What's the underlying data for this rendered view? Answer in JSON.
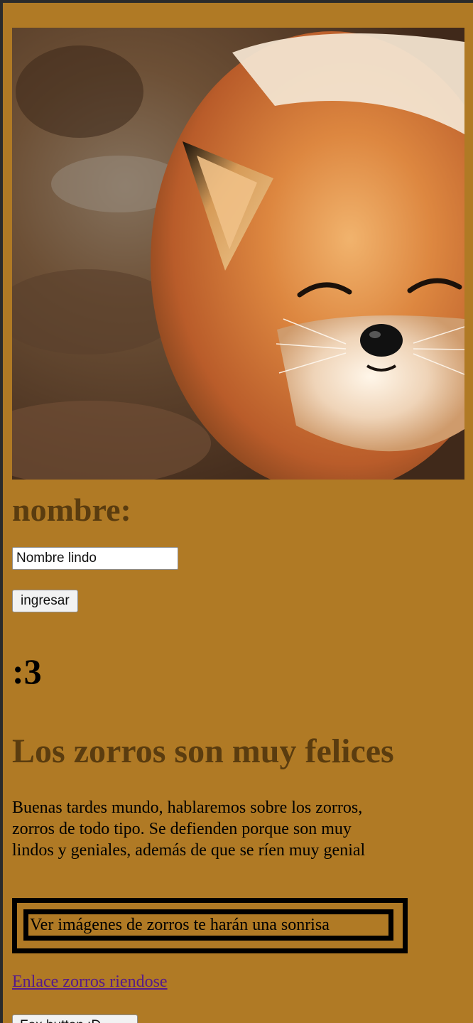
{
  "hero_image": {
    "alt": "",
    "subject": "smiling-red-fox-photo"
  },
  "form": {
    "heading": "nombre:",
    "name_value": "Nombre lindo",
    "submit_label": "ingresar"
  },
  "emoticon": ":3",
  "article": {
    "title": "Los zorros son muy felices",
    "body": "Buenas tardes mundo, hablaremos sobre los zorros, zorros de todo tipo. Se defienden porque son muy lindos y geniales, además de que se ríen muy genial",
    "framed_text": "Ver imágenes de zorros te harán una sonrisa",
    "link_label": "Enlace zorros riendose",
    "bottom_button_label": "Fox button :D"
  },
  "colors": {
    "page_background": "#b07a25",
    "heading": "#5a3c0f",
    "link": "#551a8b"
  }
}
